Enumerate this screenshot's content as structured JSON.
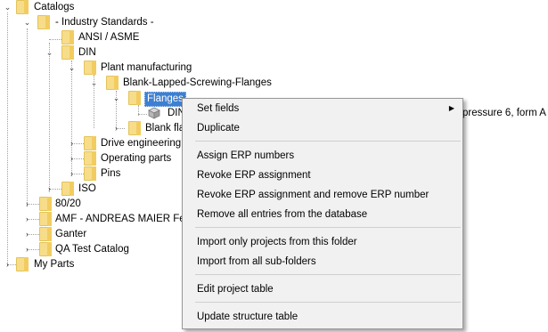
{
  "tree": {
    "catalogs": "Catalogs",
    "industry_standards": "- Industry Standards -",
    "asme": "ANSI / ASME",
    "din": "DIN",
    "plant_manufacturing": "Plant manufacturing",
    "blank_lapped": "Blank-Lapped-Screwing-Flanges",
    "flanges": "Flanges",
    "din_part": "DIN",
    "din_part_suffix": "pressure 6, form A",
    "blank_fl": "Blank fla",
    "drive_engineering": "Drive engineering",
    "operating_parts": "Operating parts",
    "pins": "Pins",
    "iso": "ISO",
    "c8020": "80/20",
    "amf": "AMF - ANDREAS MAIER  Fel",
    "ganter": "Ganter",
    "qa": "QA Test Catalog",
    "my_parts": "My Parts"
  },
  "menu": {
    "set_fields": "Set fields",
    "duplicate": "Duplicate",
    "assign_erp": "Assign ERP numbers",
    "revoke_erp": "Revoke ERP assignment",
    "revoke_remove_erp": "Revoke ERP assignment and remove ERP number",
    "remove_all": "Remove all entries from the database",
    "import_only": "Import only projects from this folder",
    "import_all": "Import from all sub-folders",
    "edit_table": "Edit project table",
    "update_structure": "Update structure table"
  },
  "icons": {
    "expanded": "chevron-down-icon",
    "collapsed": "chevron-right-icon",
    "folder": "folder-icon",
    "part": "part-cube-icon",
    "submenu": "submenu-arrow-icon"
  }
}
